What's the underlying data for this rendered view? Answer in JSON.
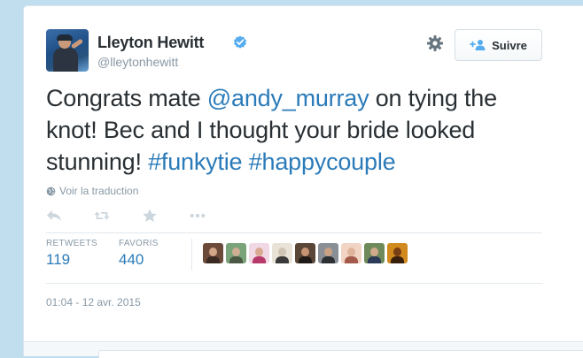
{
  "user": {
    "name": "Lleyton Hewitt",
    "handle": "@lleytonhewitt",
    "verified": true
  },
  "follow_button": {
    "label": "Suivre"
  },
  "tweet": {
    "parts": [
      {
        "text": "Congrats mate ",
        "type": "text"
      },
      {
        "text": "@andy_murray",
        "type": "mention"
      },
      {
        "text": " on tying the knot! Bec and I thought your bride looked stunning! ",
        "type": "text"
      },
      {
        "text": "#funkytie",
        "type": "hashtag"
      },
      {
        "text": " ",
        "type": "text"
      },
      {
        "text": "#happycouple",
        "type": "hashtag"
      }
    ]
  },
  "translate_label": "Voir la traduction",
  "actions": [
    {
      "name": "reply-icon"
    },
    {
      "name": "retweet-icon"
    },
    {
      "name": "favorite-icon"
    },
    {
      "name": "more-icon"
    }
  ],
  "stats": {
    "retweets_label": "RETWEETS",
    "retweets_value": "119",
    "favorites_label": "FAVORIS",
    "favorites_value": "440"
  },
  "favoriters": [
    {
      "bg": "#6b4a3a",
      "face": "#d2a689",
      "body": "#3a2a22"
    },
    {
      "bg": "#7aa37a",
      "face": "#cfae94",
      "body": "#4b5a44"
    },
    {
      "bg": "#f0d9e4",
      "face": "#d9a890",
      "body": "#b73a6a"
    },
    {
      "bg": "#e9e2d6",
      "face": "#cfc4b4",
      "body": "#3a3a3a"
    },
    {
      "bg": "#5a4536",
      "face": "#c79473",
      "body": "#1f1a17"
    },
    {
      "bg": "#8a8f96",
      "face": "#caa183",
      "body": "#2c2f33"
    },
    {
      "bg": "#f1d4c4",
      "face": "#e0b39b",
      "body": "#a35a4a"
    },
    {
      "bg": "#6f8a5a",
      "face": "#d1aa8c",
      "body": "#2b3a56"
    },
    {
      "bg": "#d08a1e",
      "face": "#7a3e14",
      "body": "#3a1f0c"
    }
  ],
  "timestamp": "01:04 - 12 avr. 2015",
  "colors": {
    "link": "#2b7bb9",
    "text": "#292f33",
    "muted": "#8899a6",
    "verified": "#55acee",
    "background": "#c0deed"
  }
}
